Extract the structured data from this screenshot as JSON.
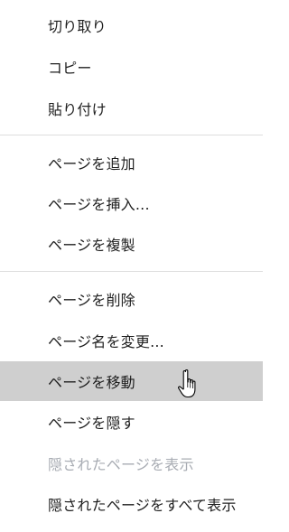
{
  "menu": {
    "items": [
      {
        "label": "切り取り"
      },
      {
        "label": "コピー"
      },
      {
        "label": "貼り付け"
      },
      {
        "label": "ページを追加"
      },
      {
        "label": "ページを挿入..."
      },
      {
        "label": "ページを複製"
      },
      {
        "label": "ページを削除"
      },
      {
        "label": "ページ名を変更..."
      },
      {
        "label": "ページを移動"
      },
      {
        "label": "ページを隠す"
      },
      {
        "label": "隠されたページを表示"
      },
      {
        "label": "隠されたページをすべて表示"
      }
    ]
  },
  "cursor": {
    "icon": "hand-pointer-icon"
  },
  "colors": {
    "hover_bg": "#cfcfcf",
    "disabled_text": "#a8acb3",
    "separator": "#dedede",
    "text": "#1f1f1f"
  }
}
